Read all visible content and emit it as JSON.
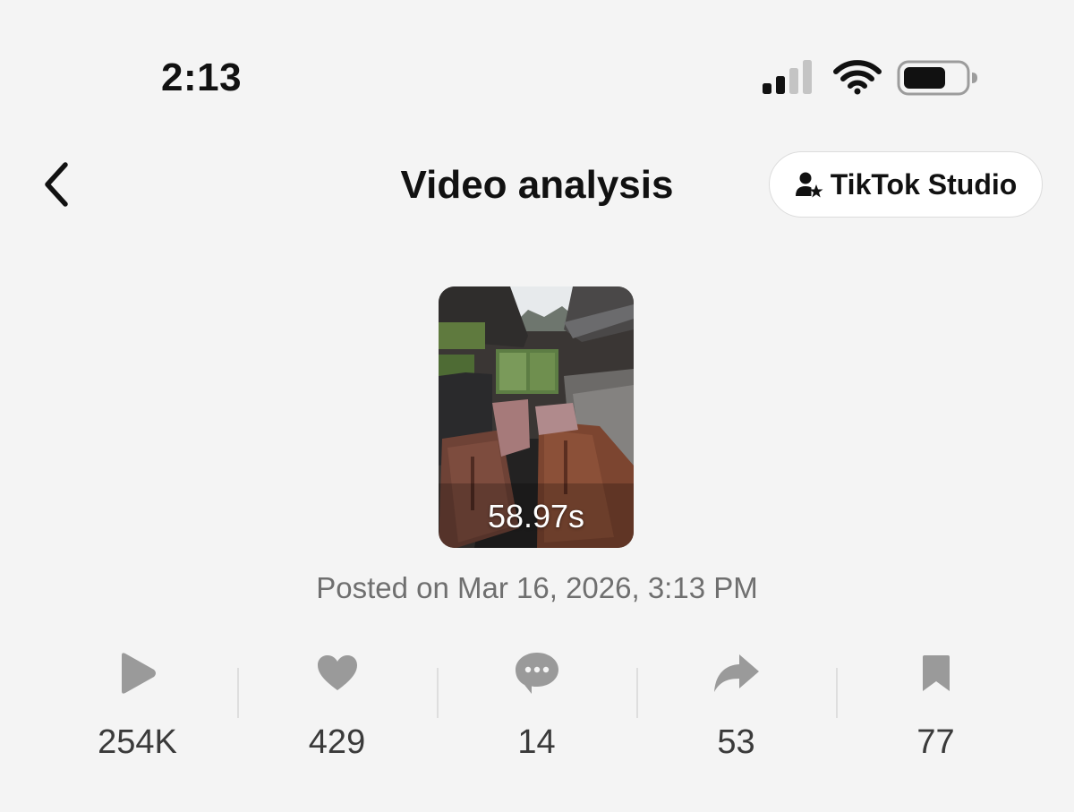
{
  "status_bar": {
    "time": "2:13"
  },
  "header": {
    "title": "Video analysis",
    "studio_button_label": "TikTok Studio"
  },
  "video": {
    "duration": "58.97s",
    "posted_on": "Posted on Mar 16, 2026, 3:13 PM"
  },
  "stats": [
    {
      "icon": "play-icon",
      "value": "254K"
    },
    {
      "icon": "heart-icon",
      "value": "429"
    },
    {
      "icon": "comment-icon",
      "value": "14"
    },
    {
      "icon": "share-icon",
      "value": "53"
    },
    {
      "icon": "bookmark-icon",
      "value": "77"
    }
  ],
  "colors": {
    "background": "#f4f4f4",
    "icon_gray": "#9a9a9a",
    "secondary_text": "#6f6f6f"
  }
}
